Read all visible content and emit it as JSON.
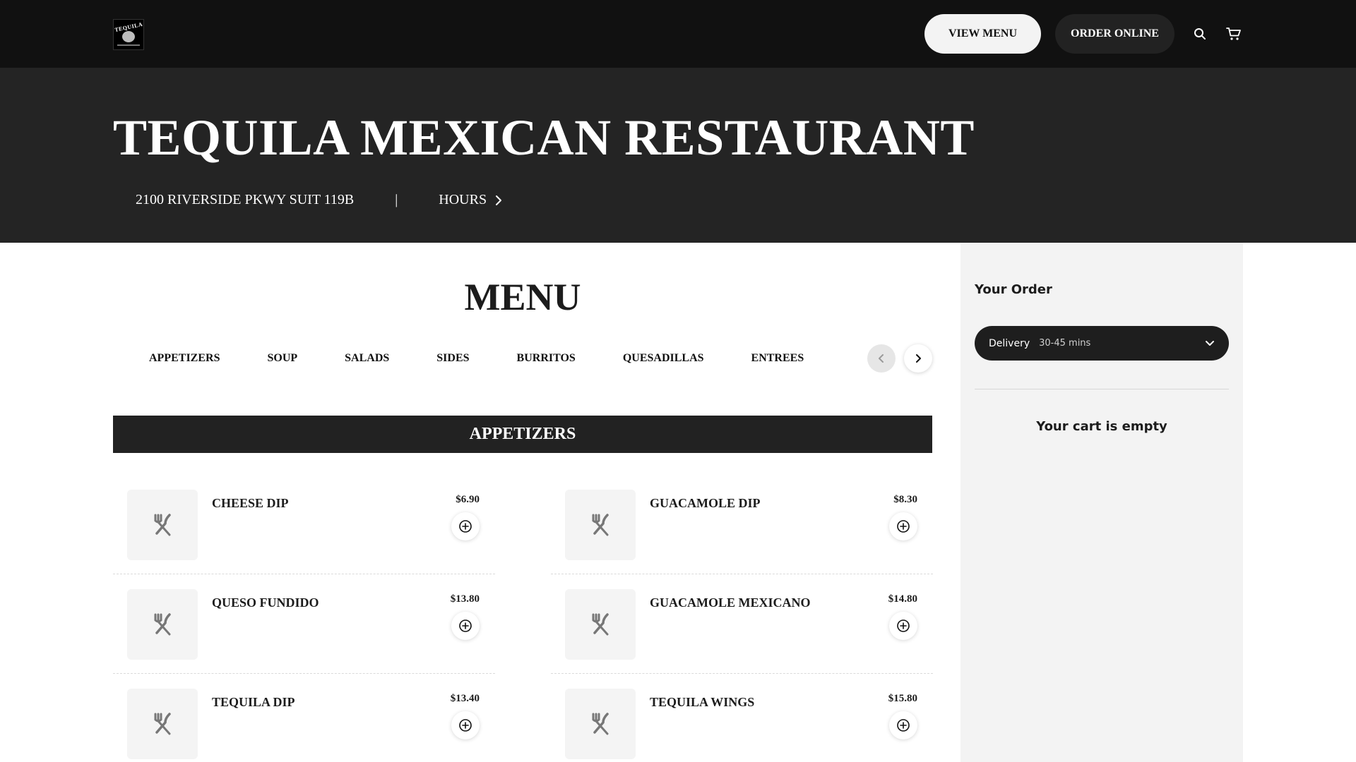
{
  "header": {
    "logo_alt": "TEQUILA",
    "view_menu_label": "VIEW MENU",
    "order_online_label": "ORDER ONLINE",
    "icons": [
      "search-icon",
      "cart-icon"
    ]
  },
  "hero": {
    "title": "TEQUILA MEXICAN RESTAURANT",
    "address": "2100 RIVERSIDE PKWY SUIT 119B",
    "separator": "|",
    "hours_label": "HOURS"
  },
  "menu": {
    "title": "MENU",
    "tabs": [
      {
        "label": "APPETIZERS"
      },
      {
        "label": "SOUP"
      },
      {
        "label": "SALADS"
      },
      {
        "label": "SIDES"
      },
      {
        "label": "BURRITOS"
      },
      {
        "label": "QUESADILLAS"
      },
      {
        "label": "ENTREES"
      }
    ],
    "section_title": "APPETIZERS",
    "items": [
      {
        "name": "CHEESE DIP",
        "price": "$6.90"
      },
      {
        "name": "GUACAMOLE DIP",
        "price": "$8.30"
      },
      {
        "name": "QUESO FUNDIDO",
        "price": "$13.80"
      },
      {
        "name": "GUACAMOLE MEXICANO",
        "price": "$14.80"
      },
      {
        "name": "TEQUILA DIP",
        "price": "$13.40"
      },
      {
        "name": "TEQUILA WINGS",
        "price": "$15.80"
      }
    ]
  },
  "order": {
    "title": "Your Order",
    "mode": "Delivery",
    "time": "30-45 mins",
    "empty_message": "Your cart is empty"
  },
  "colors": {
    "topbar": "#111111",
    "hero": "#242424",
    "section_bar": "#222222",
    "sidebar": "#f3f3f3"
  }
}
